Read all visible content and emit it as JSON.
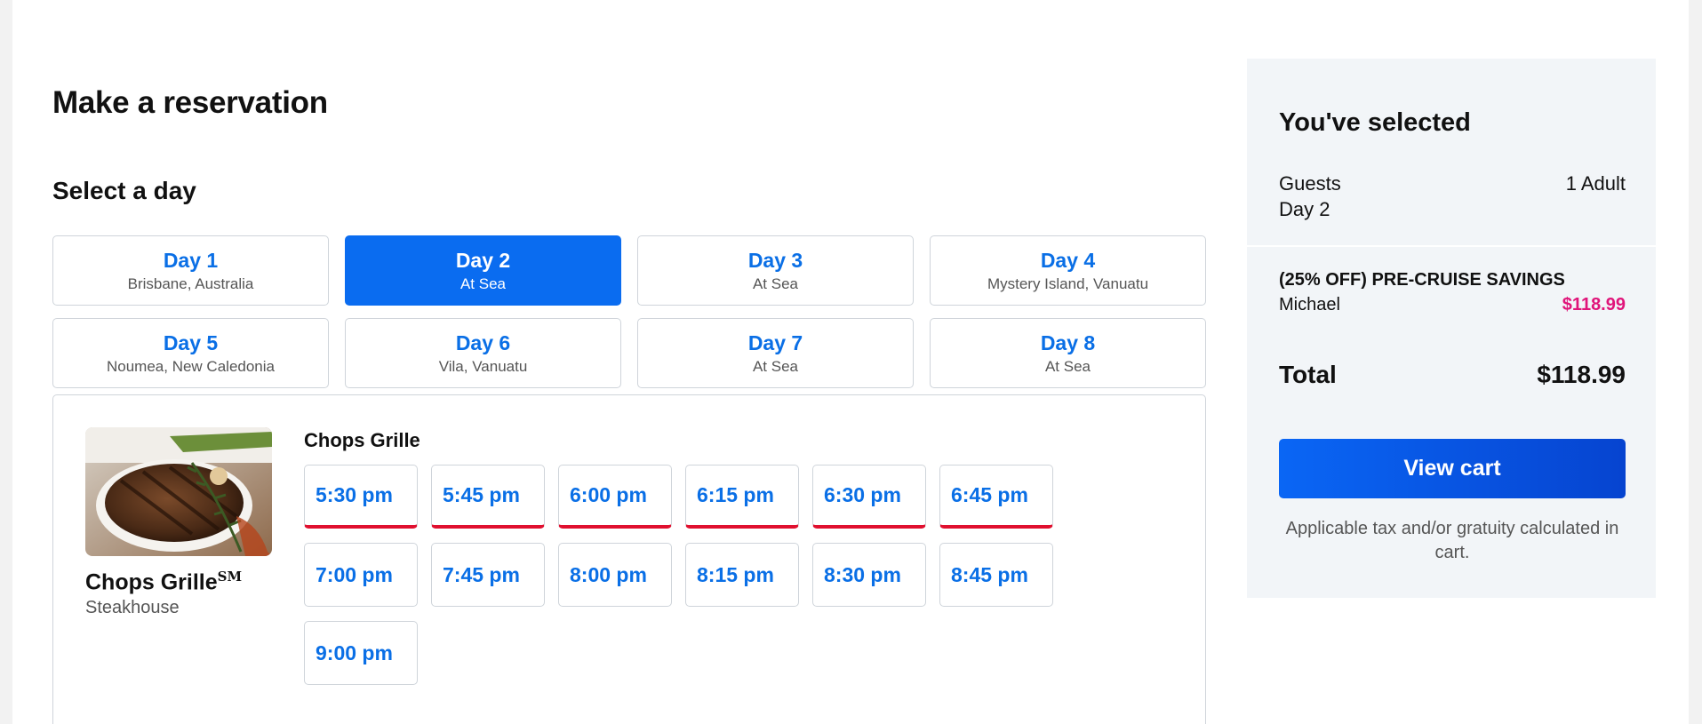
{
  "page_title": "Make a reservation",
  "day_section": {
    "title": "Select a day",
    "days": [
      {
        "label": "Day 1",
        "port": "Brisbane, Australia"
      },
      {
        "label": "Day 2",
        "port": "At Sea"
      },
      {
        "label": "Day 3",
        "port": "At Sea"
      },
      {
        "label": "Day 4",
        "port": "Mystery Island, Vanuatu"
      },
      {
        "label": "Day 5",
        "port": "Noumea, New Caledonia"
      },
      {
        "label": "Day 6",
        "port": "Vila, Vanuatu"
      },
      {
        "label": "Day 7",
        "port": "At Sea"
      },
      {
        "label": "Day 8",
        "port": "At Sea"
      }
    ],
    "selected_day": "Day 2"
  },
  "restaurant": {
    "name": "Chops Grille",
    "name_mark": "SM",
    "type": "Steakhouse",
    "menu_title": "Chops Grille",
    "times": [
      {
        "label": "5:30 pm",
        "limited": true
      },
      {
        "label": "5:45 pm",
        "limited": true
      },
      {
        "label": "6:00 pm",
        "limited": true
      },
      {
        "label": "6:15 pm",
        "limited": true
      },
      {
        "label": "6:30 pm",
        "limited": true
      },
      {
        "label": "6:45 pm",
        "limited": true
      },
      {
        "label": "7:00 pm",
        "limited": false
      },
      {
        "label": "7:45 pm",
        "limited": false
      },
      {
        "label": "8:00 pm",
        "limited": false
      },
      {
        "label": "8:15 pm",
        "limited": false
      },
      {
        "label": "8:30 pm",
        "limited": false
      },
      {
        "label": "8:45 pm",
        "limited": false
      },
      {
        "label": "9:00 pm",
        "limited": false
      }
    ]
  },
  "summary": {
    "title": "You've selected",
    "guests_label": "Guests",
    "guests_value": "1 Adult",
    "day_value": "Day 2",
    "promo_title": "(25% OFF) PRE-CRUISE SAVINGS",
    "guest_name": "Michael",
    "guest_price": "$118.99",
    "total_label": "Total",
    "total_value": "$118.99",
    "view_cart_label": "View cart",
    "note": "Applicable tax and/or gratuity calculated in cart."
  },
  "colors": {
    "accent_blue": "#0a6cf0",
    "limited_red": "#e0102f",
    "price_pink": "#e0157a",
    "summary_bg": "#f2f5f8"
  }
}
